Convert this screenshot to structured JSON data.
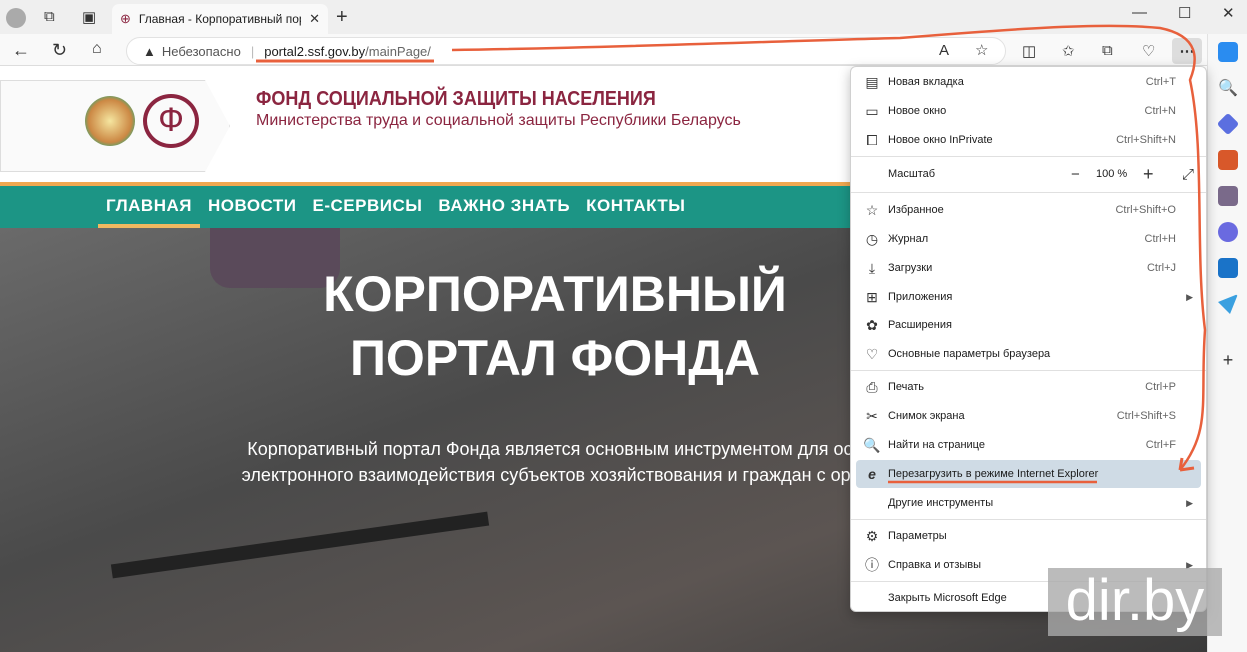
{
  "browser": {
    "tab_title": "Главная - Корпоративный портал",
    "security_label": "Небезопасно",
    "url_host": "portal2.ssf.gov.by",
    "url_path": "/mainPage/"
  },
  "site": {
    "title": "ФОНД СОЦИАЛЬНОЙ ЗАЩИТЫ НАСЕЛЕНИЯ",
    "subtitle": "Министерства труда и социальной защиты Республики Беларусь",
    "nav": [
      "ГЛАВНАЯ",
      "НОВОСТИ",
      "Е-СЕРВИСЫ",
      "ВАЖНО ЗНАТЬ",
      "КОНТАКТЫ"
    ],
    "hero_title": "КОРПОРАТИВНЫЙ ПОРТАЛ ФОНДА",
    "hero_text": "Корпоративный портал Фонда является основным инструментом для осуществления электронного взаимодействия субъектов хозяйствования и граждан с органами Фонда"
  },
  "menu": {
    "items": [
      {
        "label": "Новая вкладка",
        "shortcut": "Ctrl+T",
        "icon": "new-tab-icon"
      },
      {
        "label": "Новое окно",
        "shortcut": "Ctrl+N",
        "icon": "window-icon"
      },
      {
        "label": "Новое окно InPrivate",
        "shortcut": "Ctrl+Shift+N",
        "icon": "inprivate-icon"
      },
      {
        "label": "Избранное",
        "shortcut": "Ctrl+Shift+O",
        "icon": "favorites-icon"
      },
      {
        "label": "Журнал",
        "shortcut": "Ctrl+H",
        "icon": "history-icon"
      },
      {
        "label": "Загрузки",
        "shortcut": "Ctrl+J",
        "icon": "download-icon"
      },
      {
        "label": "Приложения",
        "shortcut": "",
        "icon": "apps-icon"
      },
      {
        "label": "Расширения",
        "shortcut": "",
        "icon": "extensions-icon"
      },
      {
        "label": "Основные параметры браузера",
        "shortcut": "",
        "icon": "health-icon"
      },
      {
        "label": "Печать",
        "shortcut": "Ctrl+P",
        "icon": "print-icon"
      },
      {
        "label": "Снимок экрана",
        "shortcut": "Ctrl+Shift+S",
        "icon": "screenshot-icon"
      },
      {
        "label": "Найти на странице",
        "shortcut": "Ctrl+F",
        "icon": "find-icon"
      },
      {
        "label": "Перезагрузить в режиме Internet Explorer",
        "shortcut": "",
        "icon": "ie-icon"
      },
      {
        "label": "Другие инструменты",
        "shortcut": "",
        "icon": ""
      },
      {
        "label": "Параметры",
        "shortcut": "",
        "icon": "settings-icon"
      },
      {
        "label": "Справка и отзывы",
        "shortcut": "",
        "icon": "help-icon"
      },
      {
        "label": "Закрыть Microsoft Edge",
        "shortcut": "",
        "icon": ""
      }
    ],
    "zoom_label": "Масштаб",
    "zoom_value": "100 %"
  },
  "watermark": "dir.by"
}
